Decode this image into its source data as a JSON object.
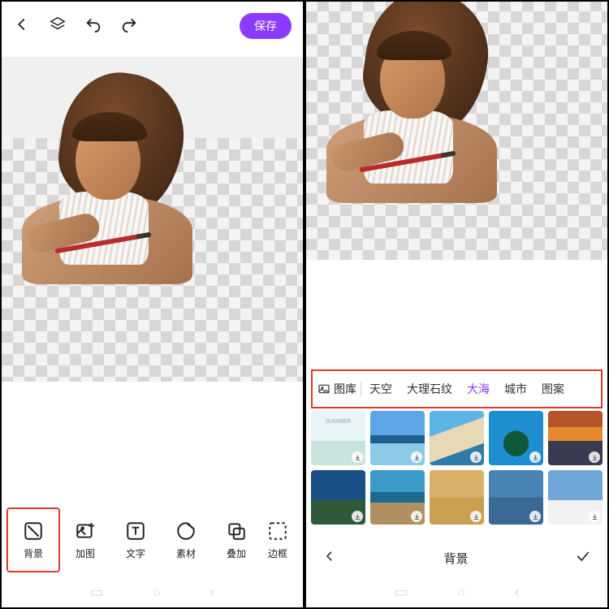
{
  "header": {
    "save_label": "保存"
  },
  "tools": [
    {
      "key": "background",
      "label": "背景",
      "selected": true
    },
    {
      "key": "add-image",
      "label": "加图",
      "selected": false
    },
    {
      "key": "text",
      "label": "文字",
      "selected": false
    },
    {
      "key": "stickers",
      "label": "素材",
      "selected": false
    },
    {
      "key": "overlay",
      "label": "叠加",
      "selected": false
    },
    {
      "key": "frame",
      "label": "边框",
      "selected": false
    }
  ],
  "right_panel": {
    "gallery_label": "图库",
    "categories": [
      {
        "key": "sky",
        "label": "天空",
        "active": false
      },
      {
        "key": "marble",
        "label": "大理石纹",
        "active": false
      },
      {
        "key": "sea",
        "label": "大海",
        "active": true
      },
      {
        "key": "city",
        "label": "城市",
        "active": false
      },
      {
        "key": "pattern",
        "label": "图案",
        "active": false
      }
    ],
    "footer_title": "背景",
    "thumb_count": 10
  },
  "colors": {
    "accent": "#8b3bff",
    "highlight_box": "#e0392c"
  }
}
